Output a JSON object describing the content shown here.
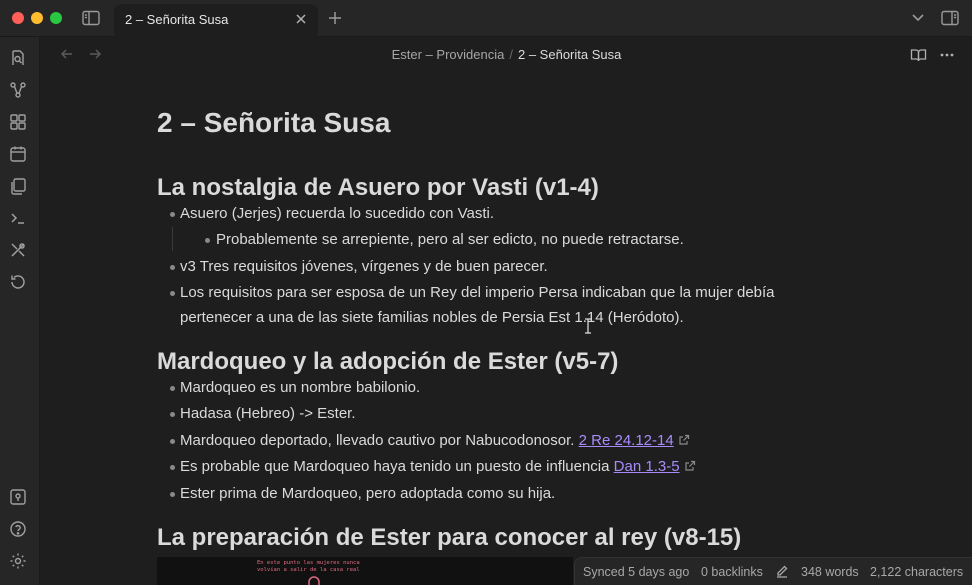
{
  "window": {
    "tab_title": "2 – Señorita Susa",
    "icons": [
      "sidebar-toggle-icon",
      "close-icon",
      "plus-icon",
      "chevron-down-icon",
      "right-sidebar-icon"
    ]
  },
  "ribbon": {
    "items": [
      "open-quick-switcher-icon",
      "graph-view-icon",
      "canvas-icon",
      "daily-note-icon",
      "templates-icon",
      "command-palette-icon",
      "excalidraw-icon",
      "history-icon"
    ],
    "bottom": [
      "vault-icon",
      "help-icon",
      "settings-icon"
    ]
  },
  "navbar": {
    "parent": "Ester – Providencia",
    "separator": "/",
    "current": "2 – Señorita Susa"
  },
  "note": {
    "title": "2 – Señorita Susa",
    "section1": {
      "heading": "La nostalgia de Asuero por Vasti (v1-4)",
      "b1": "Asuero (Jerjes) recuerda lo sucedido con Vasti.",
      "b1_sub": "Probablemente se arrepiente, pero al ser edicto, no puede retractarse.",
      "b2": "v3 Tres requisitos jóvenes, vírgenes y de buen parecer.",
      "b3_line1": "Los requisitos para ser esposa de un Rey del imperio Persa indicaban que la mujer debía",
      "b3_line2": "pertenecer a una de las siete familias nobles de Persia Est 1.14 (Heródoto)."
    },
    "section2": {
      "heading": "Mardoqueo y la adopción de Ester (v5-7)",
      "b1": "Mardoqueo es un nombre babilonio.",
      "b2": "Hadasa (Hebreo) -> Ester.",
      "b3_text": "Mardoqueo deportado, llevado cautivo por Nabucodonosor.",
      "b3_link": "2 Re 24.12-14",
      "b4_text": "Es probable que Mardoqueo haya tenido un puesto de influencia",
      "b4_link": "Dan 1.3-5",
      "b5": "Ester prima de Mardoqueo, pero adoptada como su hija."
    },
    "section3": {
      "heading": "La preparación de Ester para conocer al rey (v8-15)"
    },
    "preview_text_line1": "En este punto las mujeres nunca",
    "preview_text_line2": "volvían a salir de la casa real"
  },
  "status": {
    "synced": "Synced 5 days ago",
    "backlinks": "0 backlinks",
    "words": "348 words",
    "characters": "2,122 characters"
  },
  "colors": {
    "background": "#1e1e1e",
    "chrome": "#262626",
    "link": "#a88bfa",
    "text": "#dadada"
  }
}
